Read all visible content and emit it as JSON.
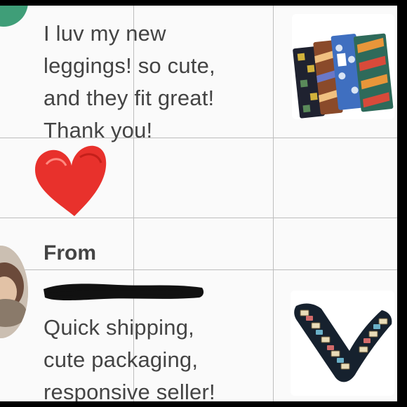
{
  "reviews": [
    {
      "text": "I luv my new\nleggings! so cute,\nand they fit great!\nThank you!",
      "product_image": "patterned-leggings-stack"
    },
    {
      "from_label": "From",
      "text": "Quick shipping,\ncute packaging,\nresponsive seller!",
      "product_image": "cassette-print-leggings"
    }
  ],
  "colors": {
    "background": "#fafafa",
    "text": "#444444",
    "grid": "#bdbdbd",
    "heart": "#e8312c",
    "avatar_green": "#3f9e78",
    "redaction": "#111111"
  }
}
